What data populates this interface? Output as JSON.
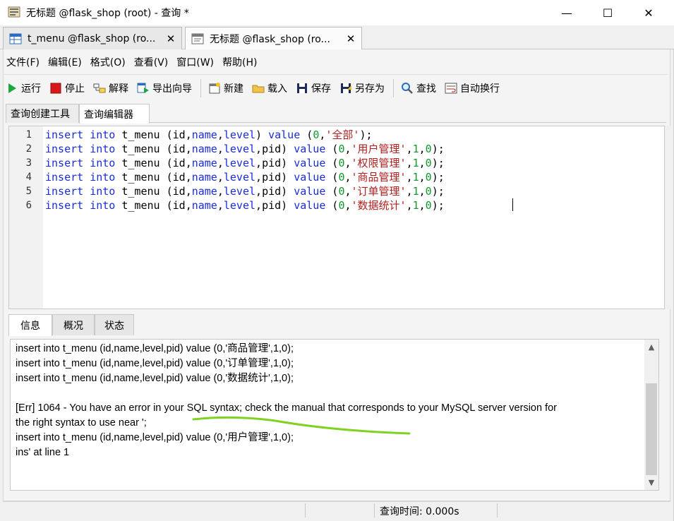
{
  "window": {
    "title": "无标题 @flask_shop (root) - 查询 *",
    "minimize": "—",
    "maximize": "☐",
    "close": "✕"
  },
  "doc_tabs": [
    {
      "label": "t_menu @flask_shop (ro...",
      "close": "✕"
    },
    {
      "label": "无标题 @flask_shop (ro...",
      "close": "✕"
    }
  ],
  "menu": [
    "文件(F)",
    "编辑(E)",
    "格式(O)",
    "查看(V)",
    "窗口(W)",
    "帮助(H)"
  ],
  "toolbar": {
    "run": "运行",
    "stop": "停止",
    "explain": "解释",
    "export": "导出向导",
    "new": "新建",
    "load": "载入",
    "save": "保存",
    "save_as": "另存为",
    "find": "查找",
    "wrap": "自动换行"
  },
  "editor_tabs": [
    "查询创建工具",
    "查询编辑器"
  ],
  "code_lines": [
    {
      "n": "1",
      "name": "全部",
      "cols": "id,name,level",
      "vals": "0,",
      "tail": ");"
    },
    {
      "n": "2",
      "name": "用户管理",
      "cols": "id,name,level,pid",
      "vals": "0,",
      "tail": ",1,0);"
    },
    {
      "n": "3",
      "name": "权限管理",
      "cols": "id,name,level,pid",
      "vals": "0,",
      "tail": ",1,0);"
    },
    {
      "n": "4",
      "name": "商品管理",
      "cols": "id,name,level,pid",
      "vals": "0,",
      "tail": ",1,0);"
    },
    {
      "n": "5",
      "name": "订单管理",
      "cols": "id,name,level,pid",
      "vals": "0,",
      "tail": ",1,0);"
    },
    {
      "n": "6",
      "name": "数据统计",
      "cols": "id,name,level,pid",
      "vals": "0,",
      "tail": ",1,0);"
    }
  ],
  "bottom_tabs": [
    "信息",
    "概况",
    "状态"
  ],
  "messages": [
    "insert into t_menu (id,name,level,pid) value (0,'商品管理',1,0);",
    "insert into t_menu (id,name,level,pid) value (0,'订单管理',1,0);",
    "insert into t_menu (id,name,level,pid) value (0,'数据统计',1,0);",
    "",
    "[Err] 1064 - You have an error in your SQL syntax; check the manual that corresponds to your MySQL server version for",
    "the right syntax to use near ';",
    "insert into t_menu (id,name,level,pid) value (0,'用户管理',1,0);",
    "ins' at line 1"
  ],
  "status": {
    "query_time": "查询时间: 0.000s"
  }
}
